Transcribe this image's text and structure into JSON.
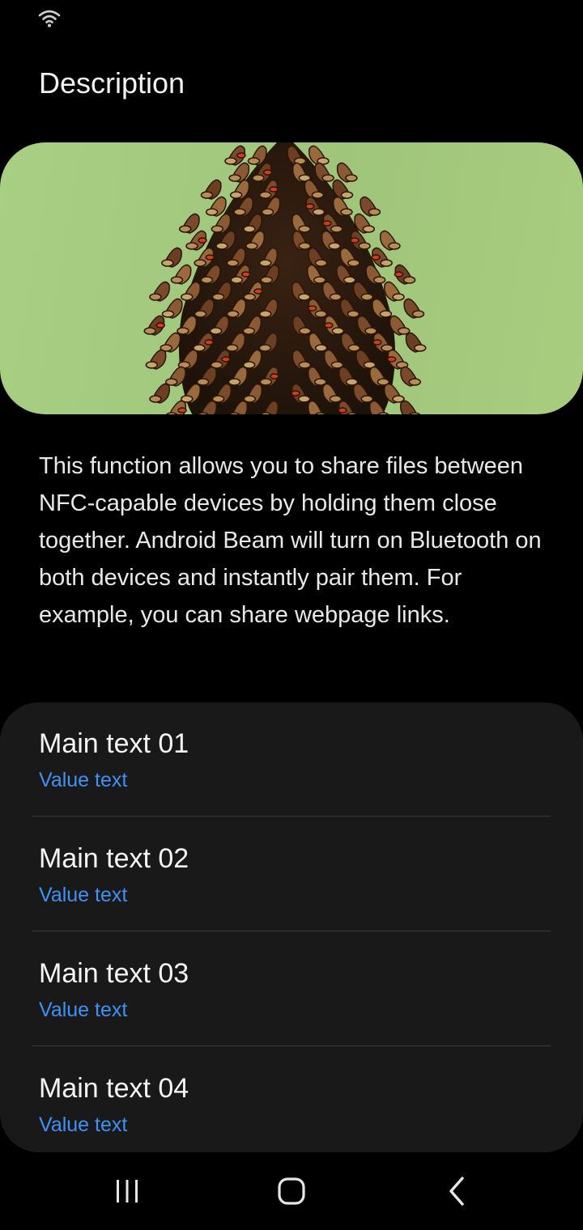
{
  "status_bar": {
    "wifi_icon": "wifi-icon"
  },
  "header": {
    "title": "Description"
  },
  "hero": {
    "image": "pinecone-illustration",
    "background_color": "#a6cc80"
  },
  "description": {
    "text": "This function allows you to share files between NFC-capable devices by holding them close together. Android Beam will turn on Bluetooth on both devices and instantly pair them. For example, you can share webpage links."
  },
  "list": {
    "items": [
      {
        "main": "Main text 01",
        "value": "Value text"
      },
      {
        "main": "Main text 02",
        "value": "Value text"
      },
      {
        "main": "Main text 03",
        "value": "Value text"
      },
      {
        "main": "Main text 04",
        "value": "Value text"
      }
    ]
  },
  "nav_bar": {
    "recents_icon": "recents-icon",
    "home_icon": "home-icon",
    "back_icon": "back-icon"
  },
  "colors": {
    "accent": "#3e91f7",
    "card_background": "#191919",
    "page_background": "#000000"
  }
}
